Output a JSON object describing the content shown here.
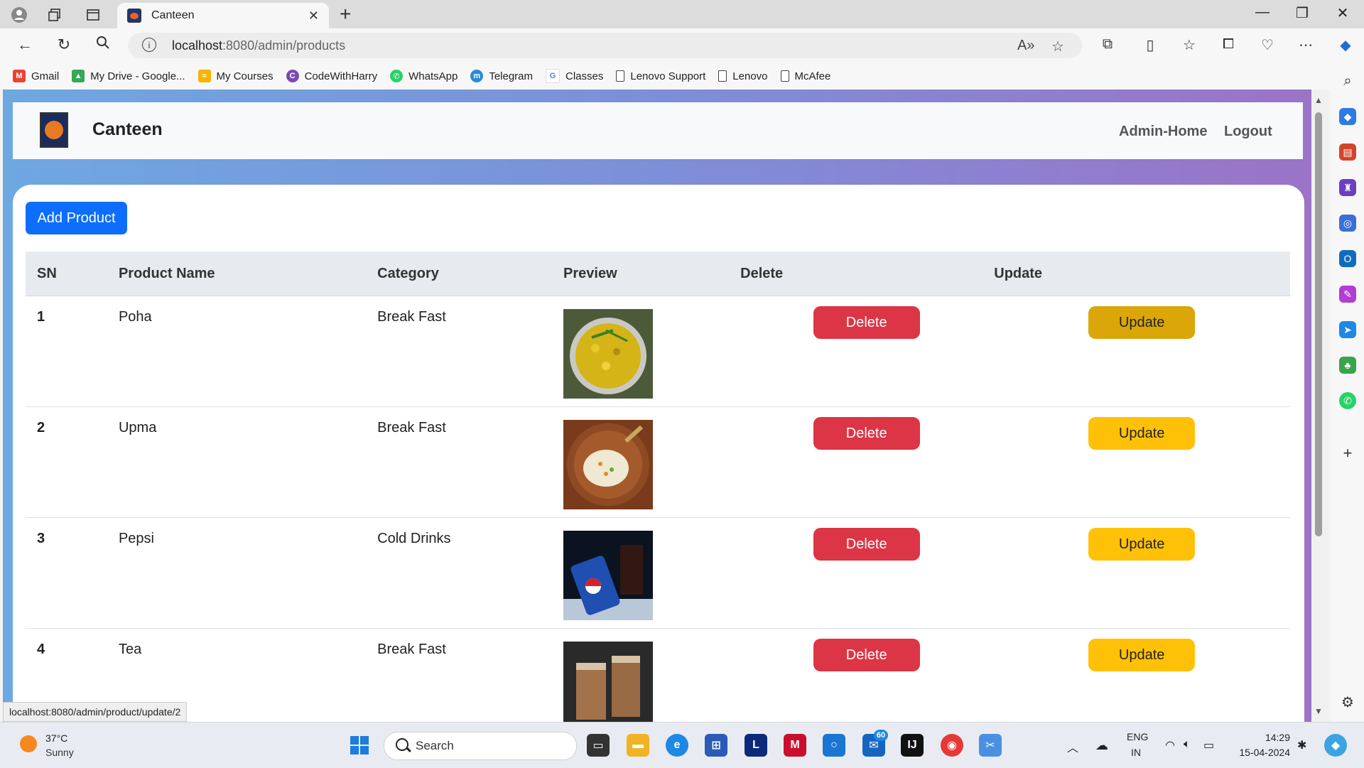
{
  "browser": {
    "tab_title": "Canteen",
    "url_host": "localhost",
    "url_path": ":8080/admin/products",
    "status_url": "localhost:8080/admin/product/update/2",
    "bookmarks": [
      "Gmail",
      "My Drive - Google...",
      "My Courses",
      "CodeWithHarry",
      "WhatsApp",
      "Telegram",
      "Classes",
      "Lenovo Support",
      "Lenovo",
      "McAfee"
    ]
  },
  "site": {
    "brand": "Canteen",
    "nav": {
      "home": "Admin-Home",
      "logout": "Logout"
    },
    "add_button": "Add Product",
    "table": {
      "headers": [
        "SN",
        "Product Name",
        "Category",
        "Preview",
        "Delete",
        "Update"
      ],
      "rows": [
        {
          "sn": "1",
          "name": "Poha",
          "category": "Break Fast",
          "delete": "Delete",
          "update": "Update"
        },
        {
          "sn": "2",
          "name": "Upma",
          "category": "Break Fast",
          "delete": "Delete",
          "update": "Update"
        },
        {
          "sn": "3",
          "name": "Pepsi",
          "category": "Cold Drinks",
          "delete": "Delete",
          "update": "Update"
        },
        {
          "sn": "4",
          "name": "Tea",
          "category": "Break Fast",
          "delete": "Delete",
          "update": "Update"
        }
      ]
    }
  },
  "taskbar": {
    "temperature": "37°C",
    "condition": "Sunny",
    "search_placeholder": "Search",
    "badge": "60",
    "lang": "ENG",
    "region": "IN",
    "time": "14:29",
    "date": "15-04-2024"
  },
  "colors": {
    "primary": "#0d6efd",
    "danger": "#dc3545",
    "warning": "#ffc107",
    "gradient_start": "#6ea8e0",
    "gradient_end": "#9b73c8"
  }
}
